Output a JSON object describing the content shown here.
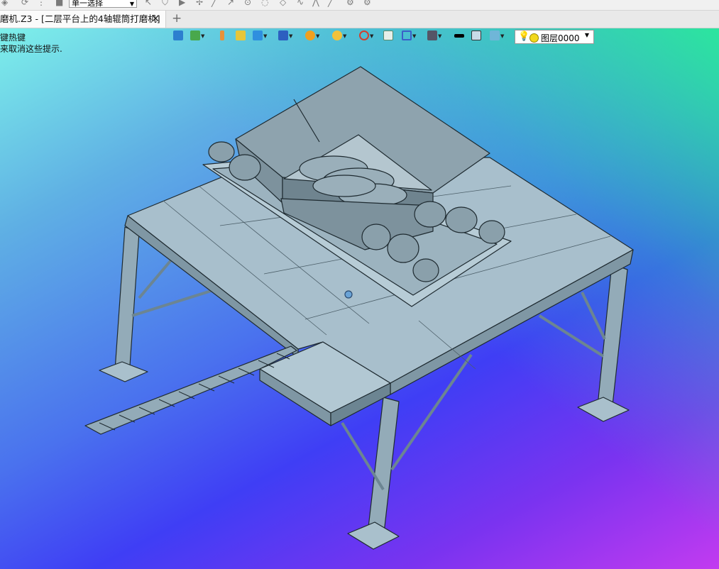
{
  "titlebar": {
    "select_mode": "单一选择"
  },
  "tabs": {
    "active": "磨机.Z3 - [二层平台上的4轴辊筒打磨机]",
    "close_glyph": "✕",
    "new_glyph": "+"
  },
  "hints": {
    "line1": "键热键",
    "line2": "来取消这些提示."
  },
  "toolbar": {
    "icons": [
      "import-icon",
      "layer-icon",
      "pencil-icon",
      "box-icon",
      "cube-icon",
      "solid-view-icon",
      "render-icon",
      "sphere-icon",
      "axis-icon",
      "grid-icon",
      "frame-icon",
      "display-icon",
      "line-color-icon",
      "fill-color-icon",
      "layer-manager-icon"
    ],
    "layer_name": "图层0000"
  },
  "colors": {
    "steel": "#a8bfcc",
    "steel_dark": "#6c8592",
    "edge": "#1e2a30",
    "hopper": "#8ea3ae"
  }
}
